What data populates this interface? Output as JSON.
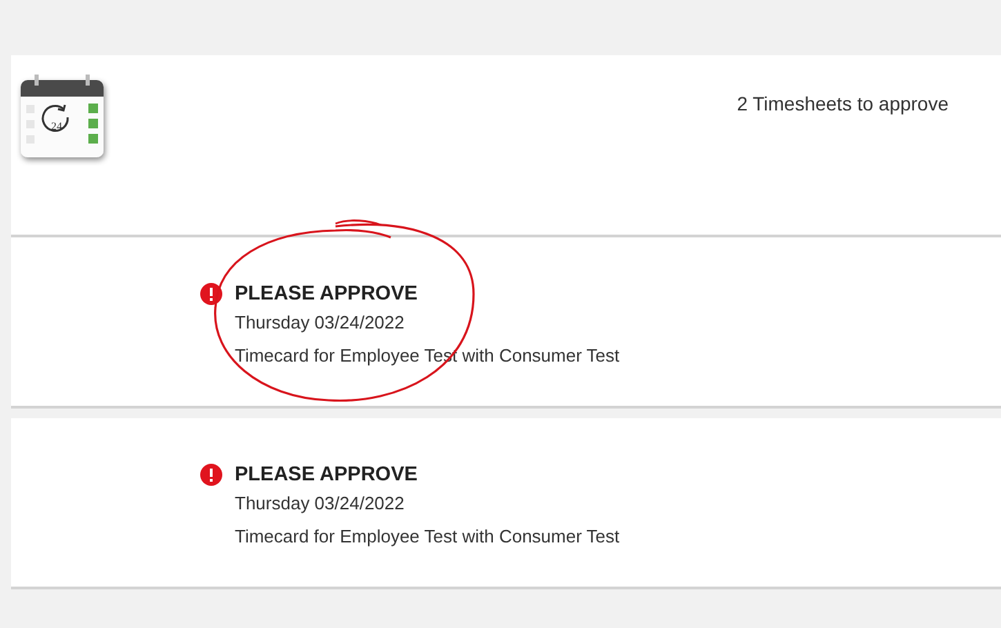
{
  "header": {
    "calendar_icon_label": "24",
    "summary": "2 Timesheets to approve"
  },
  "items": [
    {
      "title": "PLEASE APPROVE",
      "date": "Thursday 03/24/2022",
      "description": "Timecard for Employee Test with Consumer Test",
      "alert": true,
      "circled": true
    },
    {
      "title": "PLEASE APPROVE",
      "date": "Thursday 03/24/2022",
      "description": "Timecard for Employee Test with Consumer Test",
      "alert": true,
      "circled": false
    }
  ]
}
